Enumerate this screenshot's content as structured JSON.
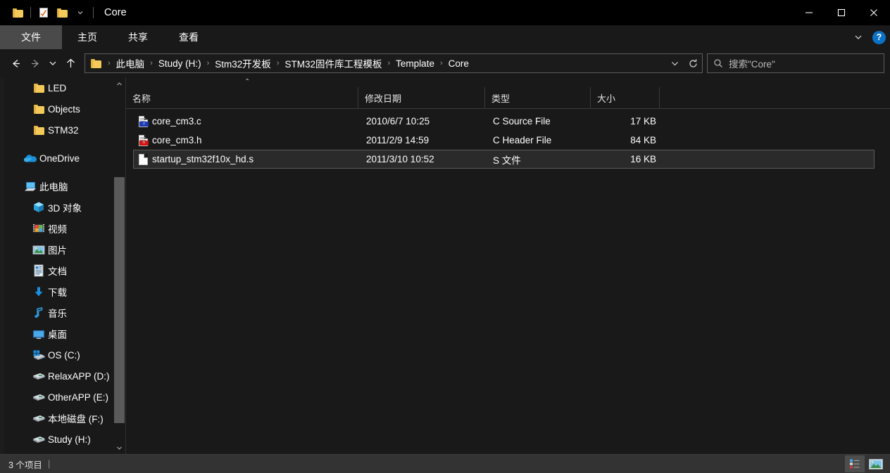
{
  "window": {
    "title": "Core",
    "quick_access": [
      {
        "name": "folder-qat-icon",
        "label": ""
      },
      {
        "name": "properties-qat-icon",
        "label": ""
      },
      {
        "name": "new-folder-qat-icon",
        "label": ""
      },
      {
        "name": "customize-qat-dropdown",
        "label": "▾"
      }
    ],
    "controls": {
      "minimize": "—",
      "maximize": "☐",
      "close": "✕"
    }
  },
  "ribbon": {
    "tabs": [
      {
        "label": "文件",
        "active": true
      },
      {
        "label": "主页",
        "active": false
      },
      {
        "label": "共享",
        "active": false
      },
      {
        "label": "查看",
        "active": false
      }
    ],
    "expand_label": "⌄",
    "help_label": "?"
  },
  "nav": {
    "back": "←",
    "forward": "→",
    "recent": "⌄",
    "up": "↑",
    "breadcrumbs": [
      "此电脑",
      "Study (H:)",
      "Stm32开发板",
      "STM32固件库工程模板",
      "Template",
      "Core"
    ],
    "separator": "›",
    "dropdown_label": "⌄",
    "refresh_label": "↻"
  },
  "search": {
    "placeholder": "搜索\"Core\"",
    "icon": "search-icon"
  },
  "sidebar": {
    "items": [
      {
        "label": "LED",
        "icon": "folder-icon",
        "indent": 2,
        "type": "folder"
      },
      {
        "label": "Objects",
        "icon": "folder-icon",
        "indent": 2,
        "type": "folder"
      },
      {
        "label": "STM32",
        "icon": "folder-icon",
        "indent": 2,
        "type": "folder"
      },
      {
        "label": "OneDrive",
        "icon": "onedrive-cloud-icon",
        "indent": 1,
        "type": "cloud"
      },
      {
        "label": "此电脑",
        "icon": "this-pc-icon",
        "indent": 1,
        "type": "pc"
      },
      {
        "label": "3D 对象",
        "icon": "3d-objects-icon",
        "indent": 2,
        "type": "3d"
      },
      {
        "label": "视频",
        "icon": "videos-icon",
        "indent": 2,
        "type": "video"
      },
      {
        "label": "图片",
        "icon": "pictures-icon",
        "indent": 2,
        "type": "picture"
      },
      {
        "label": "文档",
        "icon": "documents-icon",
        "indent": 2,
        "type": "document"
      },
      {
        "label": "下载",
        "icon": "downloads-icon",
        "indent": 2,
        "type": "download"
      },
      {
        "label": "音乐",
        "icon": "music-icon",
        "indent": 2,
        "type": "music"
      },
      {
        "label": "桌面",
        "icon": "desktop-icon",
        "indent": 2,
        "type": "desktop"
      },
      {
        "label": "OS (C:)",
        "icon": "windows-drive-icon",
        "indent": 2,
        "type": "osdrive"
      },
      {
        "label": "RelaxAPP (D:)",
        "icon": "drive-icon",
        "indent": 2,
        "type": "drive"
      },
      {
        "label": "OtherAPP (E:)",
        "icon": "drive-icon",
        "indent": 2,
        "type": "drive"
      },
      {
        "label": "本地磁盘 (F:)",
        "icon": "drive-icon",
        "indent": 2,
        "type": "drive"
      },
      {
        "label": "Study (H:)",
        "icon": "drive-icon",
        "indent": 2,
        "type": "drive"
      }
    ],
    "scroll_up": "⌃",
    "scroll_down": "⌄"
  },
  "filelist": {
    "columns": [
      {
        "key": "name",
        "label": "名称",
        "sorted": "asc"
      },
      {
        "key": "date",
        "label": "修改日期",
        "sorted": ""
      },
      {
        "key": "type",
        "label": "类型",
        "sorted": ""
      },
      {
        "key": "size",
        "label": "大小",
        "sorted": ""
      }
    ],
    "sort_caret": "⌃",
    "rows": [
      {
        "name": "core_cm3.c",
        "date": "2010/6/7 10:25",
        "type": "C Source File",
        "size": "17 KB",
        "icon": "c-source-file-icon",
        "badge": ".c",
        "selected": false
      },
      {
        "name": "core_cm3.h",
        "date": "2011/2/9 14:59",
        "type": "C Header File",
        "size": "84 KB",
        "icon": "c-header-file-icon",
        "badge": ".h",
        "selected": false
      },
      {
        "name": "startup_stm32f10x_hd.s",
        "date": "2011/3/10 10:52",
        "type": "S 文件",
        "size": "16 KB",
        "icon": "generic-file-icon",
        "badge": "",
        "selected": true
      }
    ]
  },
  "statusbar": {
    "item_count": "3 个项目",
    "separator": "|",
    "views": [
      {
        "name": "details-view-button",
        "active": true
      },
      {
        "name": "large-icons-view-button",
        "active": false
      }
    ]
  },
  "colors": {
    "background": "#191919",
    "titlebar": "#000000",
    "statusbar": "#333333",
    "accent": "#0b71c4",
    "folder": "#f3ca5a",
    "selection_border": "#5a5a5a"
  }
}
